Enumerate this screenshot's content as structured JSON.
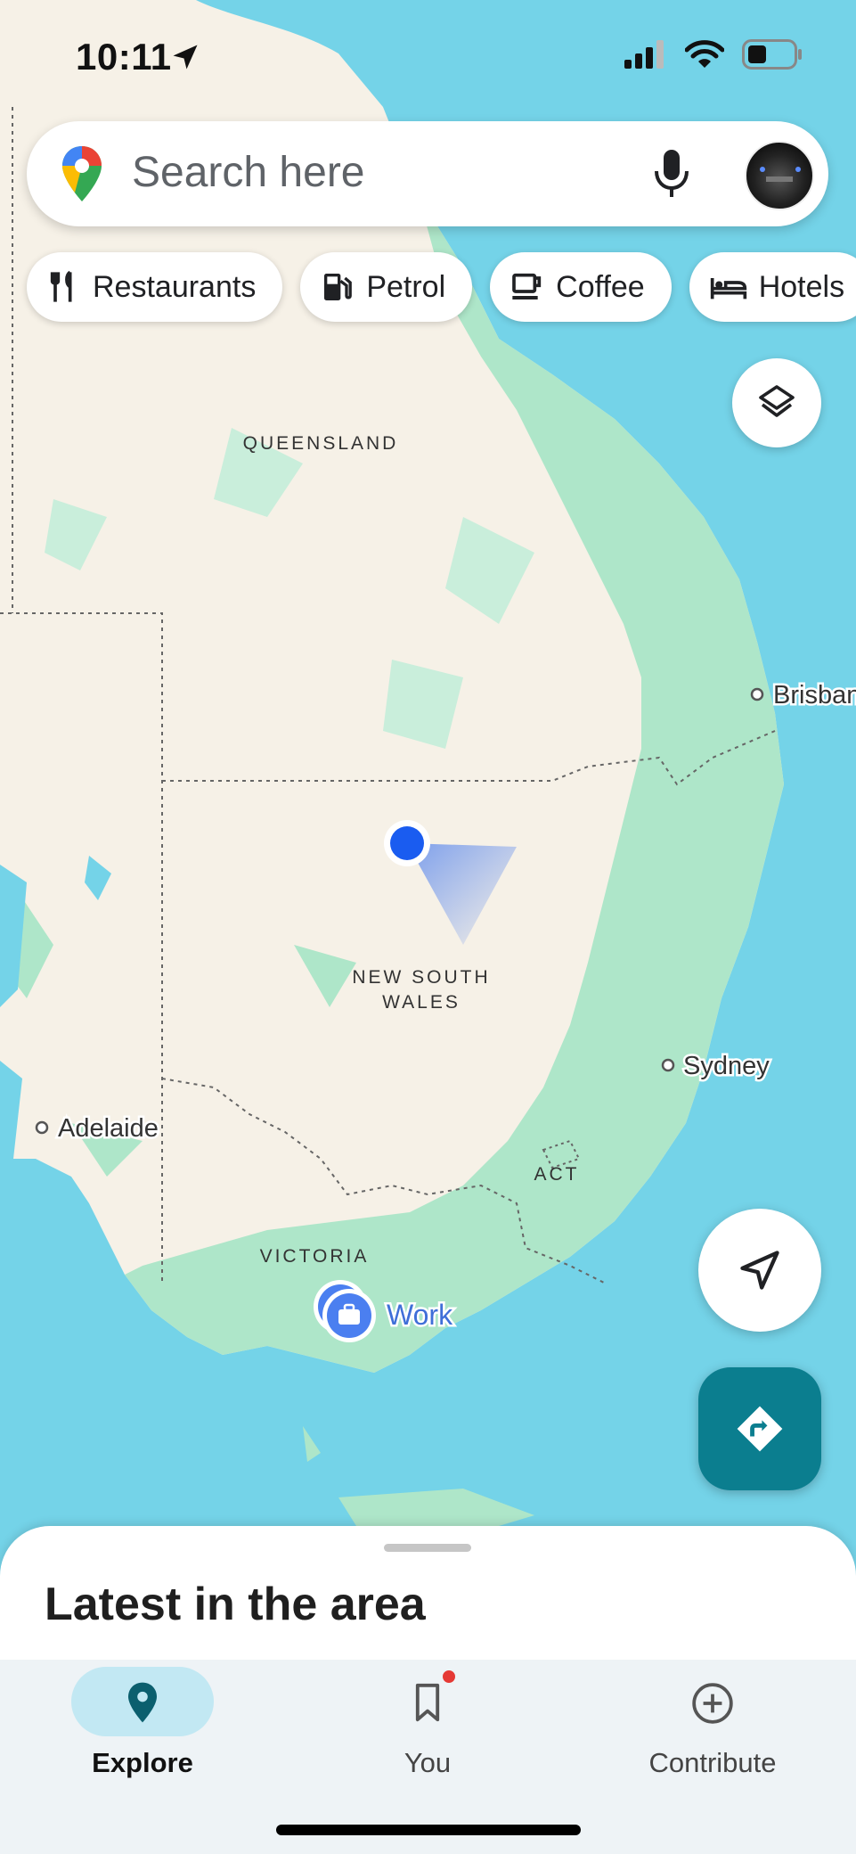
{
  "status_bar": {
    "time": "10:11"
  },
  "search": {
    "placeholder": "Search here"
  },
  "chips": [
    {
      "label": "Restaurants",
      "icon": "restaurant-icon"
    },
    {
      "label": "Petrol",
      "icon": "gas-station-icon"
    },
    {
      "label": "Coffee",
      "icon": "coffee-icon"
    },
    {
      "label": "Hotels",
      "icon": "bed-icon"
    }
  ],
  "map": {
    "labels": {
      "queensland": "QUEENSLAND",
      "nsw_line1": "NEW SOUTH",
      "nsw_line2": "WALES",
      "victoria": "VICTORIA",
      "act": "ACT",
      "brisbane": "Brisbane",
      "sydney": "Sydney",
      "adelaide": "Adelaide",
      "work": "Work"
    }
  },
  "sheet": {
    "title": "Latest in the area"
  },
  "nav": {
    "explore": "Explore",
    "you": "You",
    "contribute": "Contribute"
  },
  "colors": {
    "water": "#74d3e8",
    "land": "#f6f1e7",
    "forest": "#aee6c9",
    "directions_fab": "#0b7e8f",
    "location_dot": "#1a5cf0",
    "explore_pill": "#c2e8f3"
  }
}
